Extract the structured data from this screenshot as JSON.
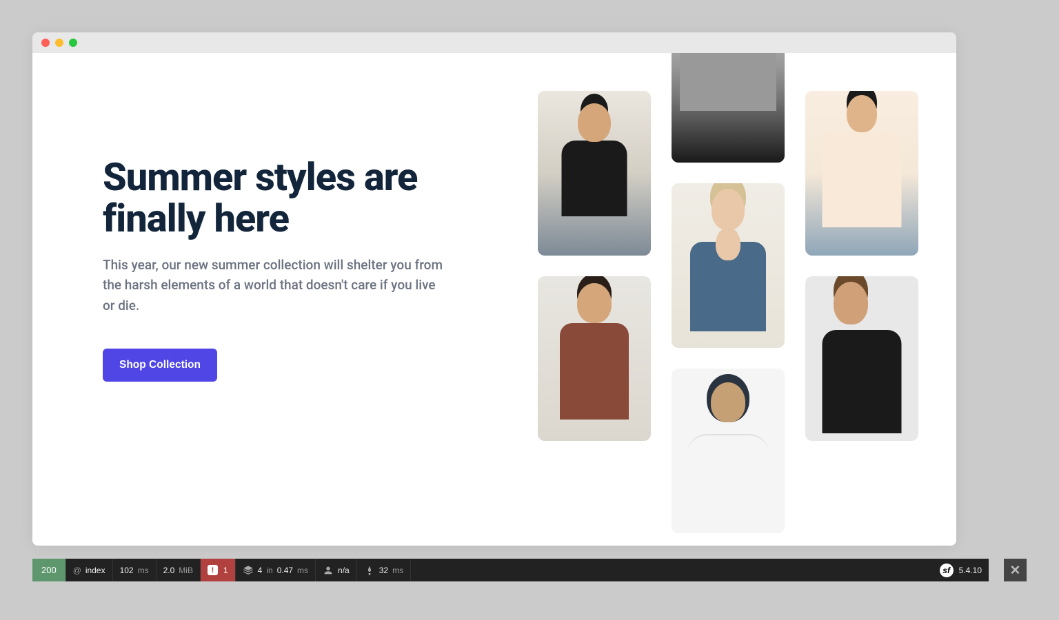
{
  "hero": {
    "title": "Summer styles are finally here",
    "subtitle": "This year, our new summer collection will shelter you from the harsh elements of a world that doesn't care if you live or die.",
    "cta_label": "Shop Collection"
  },
  "debug_toolbar": {
    "status_code": "200",
    "route_symbol": "@",
    "route_name": "index",
    "time_value": "102",
    "time_unit": "ms",
    "memory_value": "2.0",
    "memory_unit": "MiB",
    "error_count": "1",
    "cache_count": "4",
    "cache_in": "in",
    "cache_time": "0.47",
    "cache_unit": "ms",
    "user": "n/a",
    "twig_value": "32",
    "twig_unit": "ms",
    "symfony_version": "5.4.10"
  },
  "images": {
    "col1": [
      "model-woman-black-tee-denim-jacket",
      "model-man-brown-tee"
    ],
    "col2": [
      "model-torso-grey-tee",
      "model-woman-denim-jacket-cream-top",
      "model-man-beanie-glasses-white-tee"
    ],
    "col3": [
      "model-woman-peach-heart-tee",
      "model-man-black-tee-side"
    ]
  }
}
